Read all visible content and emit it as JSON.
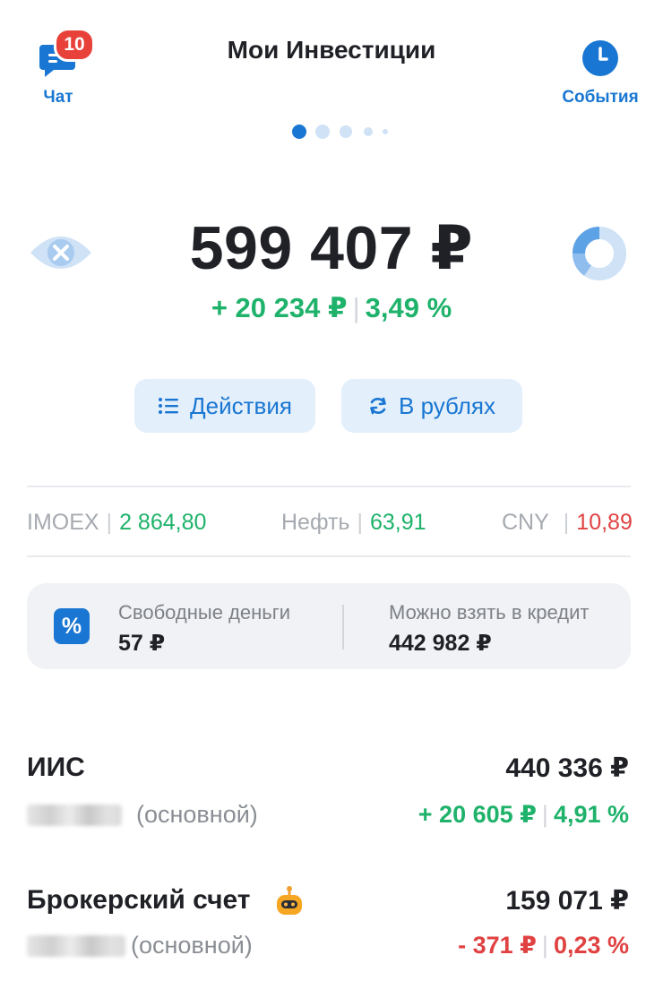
{
  "header": {
    "title": "Мои Инвестиции",
    "chat": {
      "label": "Чат",
      "badge": "10",
      "icon": "chat-icon"
    },
    "events": {
      "label": "События",
      "icon": "clock-icon"
    },
    "pager": {
      "total_dots": 5,
      "active_index": 0
    }
  },
  "portfolio": {
    "total": "599 407 ₽",
    "change_amount": "+ 20 234 ₽",
    "change_percent": "3,49 %",
    "hide_icon": "eye-hidden-icon",
    "chart_icon": "donut-chart-icon"
  },
  "actions": {
    "actions_label": "Действия",
    "currency_label": "В рублях"
  },
  "market": [
    {
      "name": "IMOEX",
      "value": "2 864,80",
      "trend": "up"
    },
    {
      "name": "Нефть",
      "value": "63,91",
      "trend": "up"
    },
    {
      "name": "CNY",
      "value": "10,89",
      "trend": "down"
    }
  ],
  "money": {
    "free_label": "Свободные деньги",
    "free_value": "57 ₽",
    "credit_label": "Можно взять в кредит",
    "credit_value": "442 982 ₽"
  },
  "accounts": [
    {
      "name": "ИИС",
      "amount": "440 336 ₽",
      "tag": "(основной)",
      "change_amount": "+ 20 605 ₽",
      "change_percent": "4,91 %",
      "trend": "up"
    },
    {
      "name": "Брокерский счет",
      "amount": "159 071 ₽",
      "tag": "(основной)",
      "change_amount": "- 371 ₽",
      "change_percent": "0,23 %",
      "trend": "down",
      "icon": "robot-icon"
    }
  ],
  "colors": {
    "accent": "#1976d2",
    "positive": "#1eb26a",
    "negative": "#e04242",
    "badge": "#e8413a"
  }
}
